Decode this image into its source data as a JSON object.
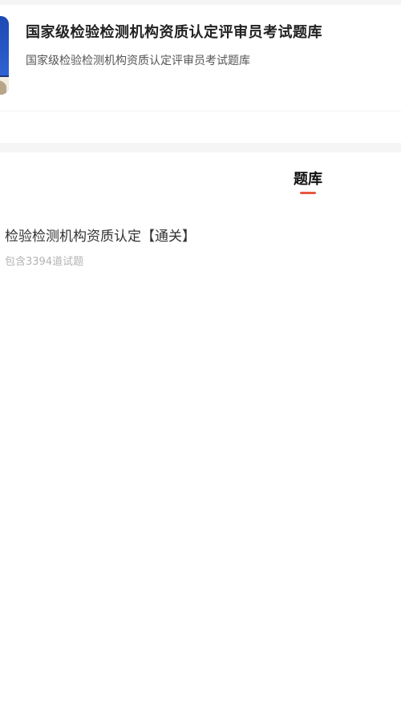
{
  "header": {
    "title": "国家级检验检测机构资质认定评审员考试题库",
    "subtitle": "国家级检验检测机构资质认定评审员考试题库"
  },
  "tabs": [
    {
      "label": "题库",
      "active": true
    }
  ],
  "question_banks": [
    {
      "title": "检验检测机构资质认定【通关】",
      "count_text": "包含3394道试题"
    }
  ],
  "colors": {
    "accent": "#e9573f",
    "cover_blue": "#2e60d0",
    "background_band": "#f5f5f5"
  }
}
